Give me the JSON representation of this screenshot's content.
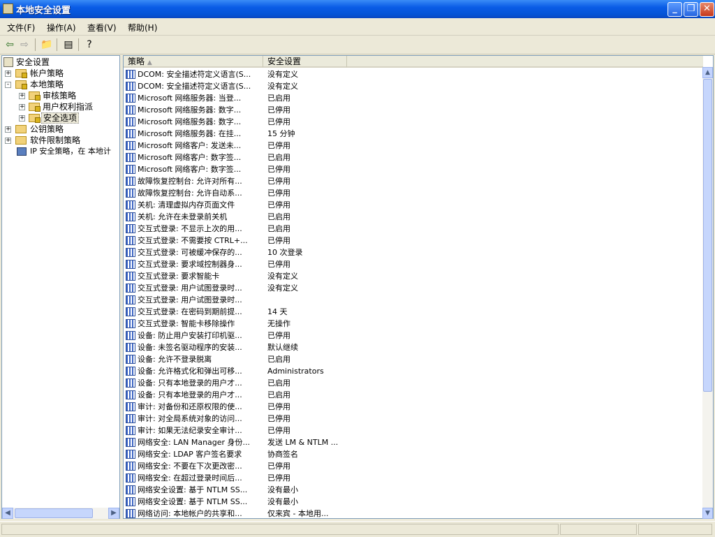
{
  "window": {
    "title": "本地安全设置"
  },
  "menu": {
    "items": [
      "文件(F)",
      "操作(A)",
      "查看(V)",
      "帮助(H)"
    ]
  },
  "toolbar": {
    "icons": [
      "back-icon",
      "forward-icon",
      "up-folder-icon",
      "export-list-icon",
      "help-icon"
    ]
  },
  "tree": {
    "root": "安全设置",
    "items": [
      {
        "label": "帐户策略",
        "level": 1,
        "expander": "+"
      },
      {
        "label": "本地策略",
        "level": 1,
        "expander": "-"
      },
      {
        "label": "审核策略",
        "level": 2,
        "expander": "+"
      },
      {
        "label": "用户权利指派",
        "level": 2,
        "expander": "+"
      },
      {
        "label": "安全选项",
        "level": 2,
        "expander": "+",
        "selected": true
      },
      {
        "label": "公钥策略",
        "level": 1,
        "expander": "+"
      },
      {
        "label": "软件限制策略",
        "level": 1,
        "expander": "+"
      },
      {
        "label": "IP 安全策略，在 本地计",
        "level": 1,
        "expander": ""
      }
    ]
  },
  "list": {
    "columns": [
      "策略 ",
      "安全设置"
    ],
    "rows": [
      [
        "DCOM: 安全描述符定义语言(S...",
        "没有定义"
      ],
      [
        "DCOM: 安全描述符定义语言(S...",
        "没有定义"
      ],
      [
        "Microsoft 网络服务器: 当登...",
        "已启用"
      ],
      [
        "Microsoft 网络服务器: 数字...",
        "已停用"
      ],
      [
        "Microsoft 网络服务器: 数字...",
        "已停用"
      ],
      [
        "Microsoft 网络服务器: 在挂...",
        "15 分钟"
      ],
      [
        "Microsoft 网络客户: 发送未...",
        "已停用"
      ],
      [
        "Microsoft 网络客户: 数字签...",
        "已启用"
      ],
      [
        "Microsoft 网络客户: 数字签...",
        "已停用"
      ],
      [
        "故障恢复控制台: 允许对所有...",
        "已停用"
      ],
      [
        "故障恢复控制台: 允许自动系...",
        "已停用"
      ],
      [
        "关机: 清理虚拟内存页面文件",
        "已停用"
      ],
      [
        "关机: 允许在未登录前关机",
        "已启用"
      ],
      [
        "交互式登录: 不显示上次的用...",
        "已启用"
      ],
      [
        "交互式登录: 不需要按 CTRL+...",
        "已停用"
      ],
      [
        "交互式登录: 可被缓冲保存的...",
        "10 次登录"
      ],
      [
        "交互式登录: 要求域控制器身...",
        "已停用"
      ],
      [
        "交互式登录: 要求智能卡",
        "没有定义"
      ],
      [
        "交互式登录: 用户试图登录时...",
        "没有定义"
      ],
      [
        "交互式登录: 用户试图登录时...",
        ""
      ],
      [
        "交互式登录: 在密码到期前提...",
        "14 天"
      ],
      [
        "交互式登录: 智能卡移除操作",
        "无操作"
      ],
      [
        "设备: 防止用户安装打印机驱...",
        "已停用"
      ],
      [
        "设备: 未签名驱动程序的安装...",
        "默认继续"
      ],
      [
        "设备: 允许不登录脱离",
        "已启用"
      ],
      [
        "设备: 允许格式化和弹出可移...",
        "Administrators"
      ],
      [
        "设备: 只有本地登录的用户才...",
        "已启用"
      ],
      [
        "设备: 只有本地登录的用户才...",
        "已启用"
      ],
      [
        "审计: 对备份和还原权限的使...",
        "已停用"
      ],
      [
        "审计: 对全局系统对象的访问...",
        "已停用"
      ],
      [
        "审计: 如果无法纪录安全审计...",
        "已停用"
      ],
      [
        "网络安全: LAN Manager 身份...",
        "发送 LM & NTLM ..."
      ],
      [
        "网络安全: LDAP 客户签名要求",
        "协商签名"
      ],
      [
        "网络安全: 不要在下次更改密...",
        "已停用"
      ],
      [
        "网络安全: 在超过登录时间后...",
        "已停用"
      ],
      [
        "网络安全设置: 基于 NTLM SS...",
        "没有最小"
      ],
      [
        "网络安全设置: 基于 NTLM SS...",
        "没有最小"
      ],
      [
        "网络访问: 本地帐户的共享和...",
        "仅来宾 - 本地用..."
      ]
    ]
  }
}
